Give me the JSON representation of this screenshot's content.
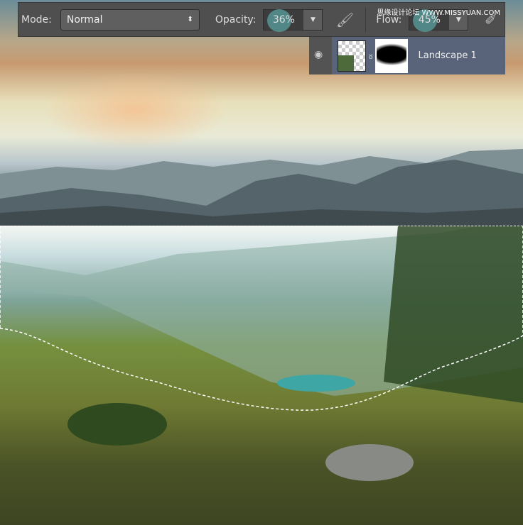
{
  "toolbar": {
    "mode_label": "Mode:",
    "mode_value": "Normal",
    "opacity_label": "Opacity:",
    "opacity_value": "36%",
    "flow_label": "Flow:",
    "flow_value": "45%"
  },
  "layers": {
    "layer_name": "Landscape 1"
  },
  "watermark": "思缘设计论坛 WWW.MISSYUAN.COM"
}
